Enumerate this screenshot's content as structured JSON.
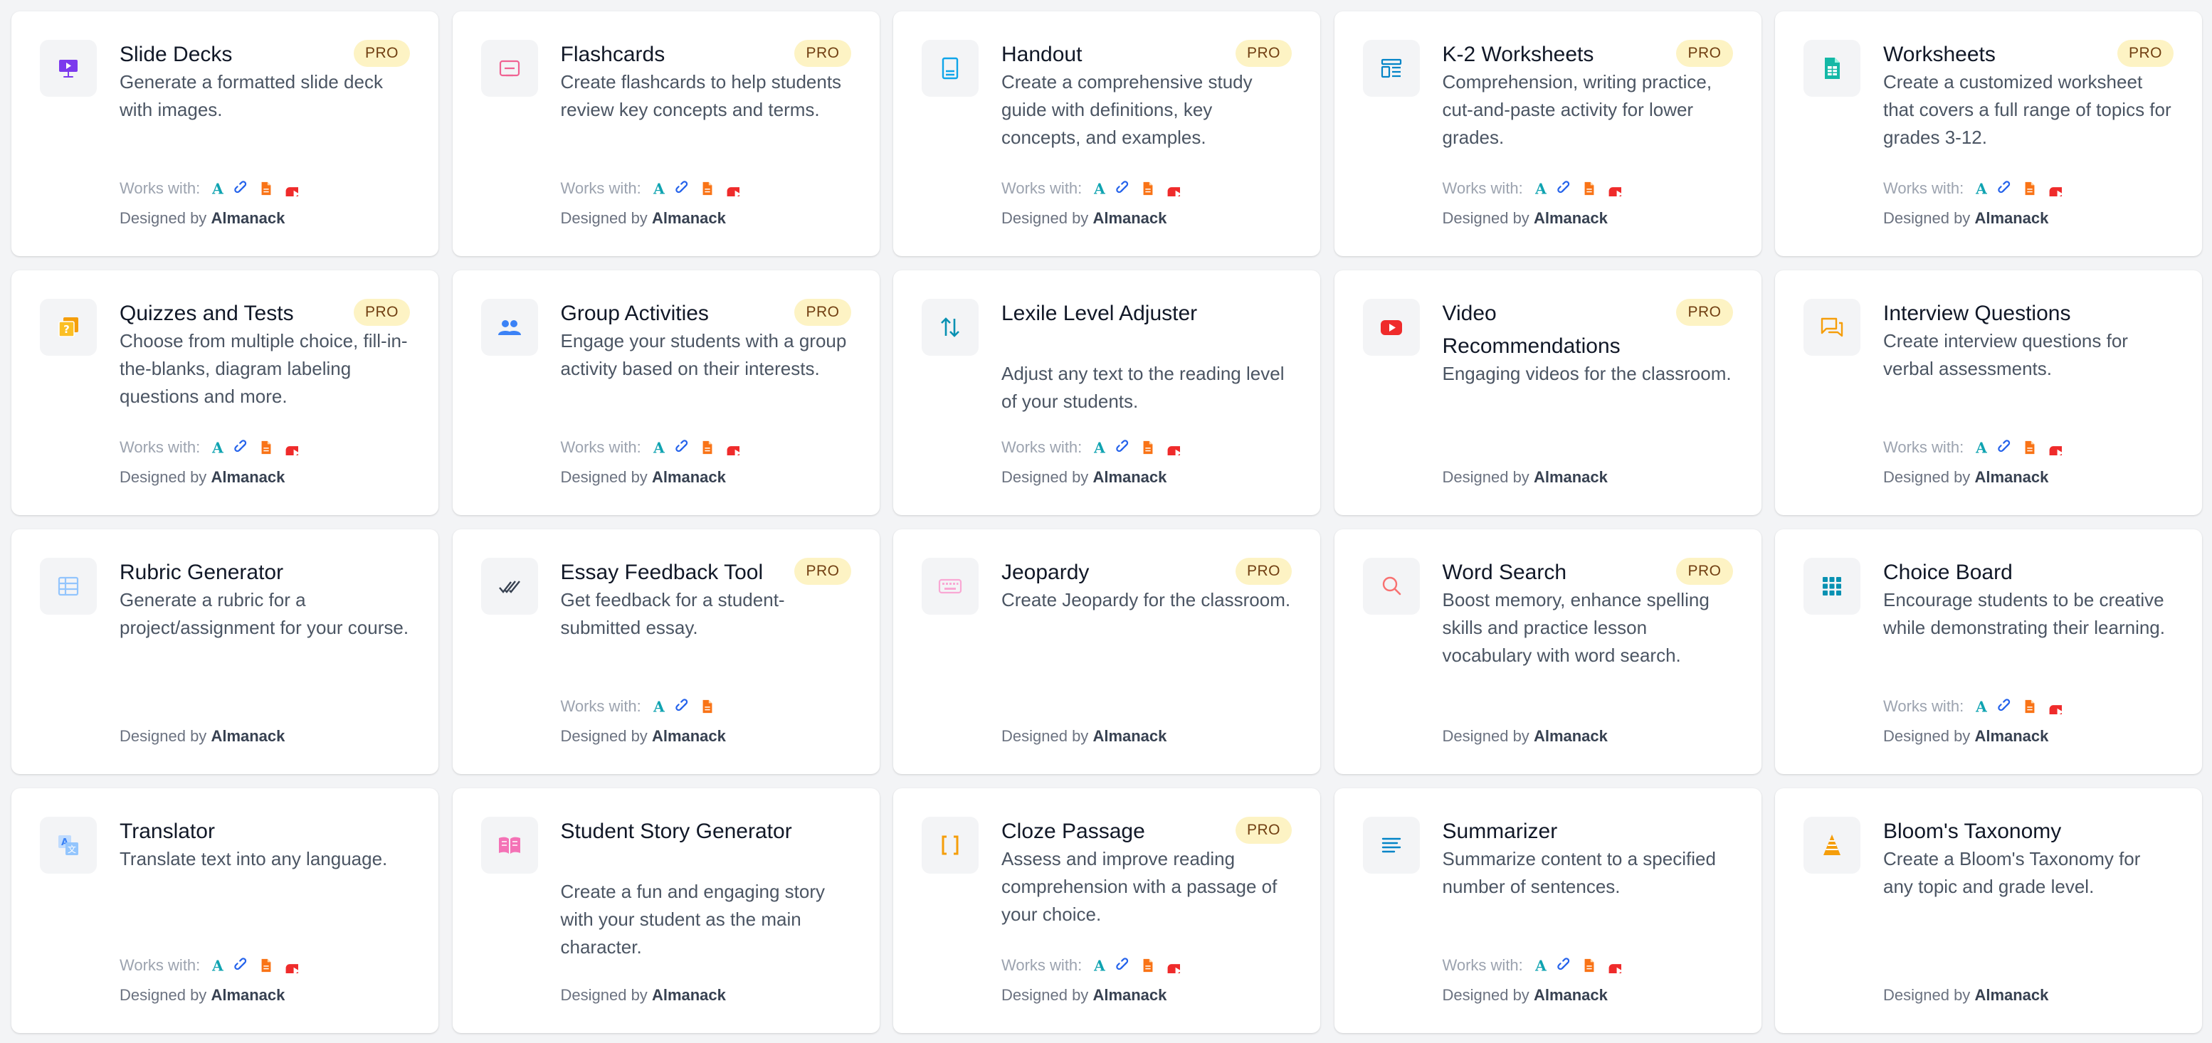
{
  "labels": {
    "pro": "PRO",
    "works_with": "Works with:",
    "designed_by": "Designed by",
    "designer": "Almanack"
  },
  "colors": {
    "page_bg": "#f3f4f6",
    "pro_bg": "#fdf3c4",
    "pro_text": "#713f12"
  },
  "integrations": [
    {
      "name": "almanack-a-icon",
      "color": "#0fa3b1"
    },
    {
      "name": "link-icon",
      "color": "#2563eb"
    },
    {
      "name": "document-icon",
      "color": "#f97316"
    },
    {
      "name": "youtube-icon",
      "color": "#ef2b2b"
    }
  ],
  "cards": [
    {
      "id": "slide-decks",
      "title": "Slide Decks",
      "description": "Generate a formatted slide deck with images.",
      "pro": true,
      "icon": "presentation-icon",
      "works_with": [
        0,
        1,
        2,
        3
      ]
    },
    {
      "id": "flashcards",
      "title": "Flashcards",
      "description": "Create flashcards to help students review key concepts and terms.",
      "pro": true,
      "icon": "flashcard-icon",
      "works_with": [
        0,
        1,
        2,
        3
      ]
    },
    {
      "id": "handout",
      "title": "Handout",
      "description": "Create a comprehensive study guide with definitions, key concepts, and examples.",
      "pro": true,
      "icon": "handout-icon",
      "works_with": [
        0,
        1,
        2,
        3
      ]
    },
    {
      "id": "k2-worksheets",
      "title": "K-2 Worksheets",
      "description": "Comprehension, writing practice, cut-and-paste activity for lower grades.",
      "pro": true,
      "icon": "layout-icon",
      "works_with": [
        0,
        1,
        2,
        3
      ]
    },
    {
      "id": "worksheets",
      "title": "Worksheets",
      "description": "Create a customized worksheet that covers a full range of topics for grades 3-12.",
      "pro": true,
      "icon": "spreadsheet-icon",
      "works_with": [
        0,
        1,
        2,
        3
      ]
    },
    {
      "id": "quizzes-and-tests",
      "title": "Quizzes and Tests",
      "description": "Choose from multiple choice, fill-in-the-blanks, diagram labeling questions and more.",
      "pro": true,
      "icon": "quiz-icon",
      "works_with": [
        0,
        1,
        2,
        3
      ]
    },
    {
      "id": "group-activities",
      "title": "Group Activities",
      "description": "Engage your students with a group activity based on their interests.",
      "pro": true,
      "icon": "people-icon",
      "works_with": [
        0,
        1,
        2,
        3
      ]
    },
    {
      "id": "lexile-level-adjuster",
      "title": "Lexile Level Adjuster",
      "description": "Adjust any text to the reading level of your students.",
      "pro": false,
      "icon": "arrows-updown-icon",
      "works_with": [
        0,
        1,
        2,
        3
      ]
    },
    {
      "id": "video-recommendations",
      "title": "Video Recommendations",
      "description": "Engaging videos for the classroom.",
      "pro": true,
      "icon": "youtube-icon",
      "works_with": []
    },
    {
      "id": "interview-questions",
      "title": "Interview Questions",
      "description": "Create interview questions for verbal assessments.",
      "pro": false,
      "icon": "chat-icon",
      "works_with": [
        0,
        1,
        2,
        3
      ]
    },
    {
      "id": "rubric-generator",
      "title": "Rubric Generator",
      "description": "Generate a rubric for a project/assignment for your course.",
      "pro": false,
      "icon": "table-icon",
      "works_with": []
    },
    {
      "id": "essay-feedback-tool",
      "title": "Essay Feedback Tool",
      "description": "Get feedback for a student-submitted essay.",
      "pro": true,
      "icon": "double-check-icon",
      "works_with": [
        0,
        1,
        2
      ]
    },
    {
      "id": "jeopardy",
      "title": "Jeopardy",
      "description": "Create Jeopardy for the classroom.",
      "pro": true,
      "icon": "keyboard-icon",
      "works_with": []
    },
    {
      "id": "word-search",
      "title": "Word Search",
      "description": "Boost memory, enhance spelling skills and practice lesson vocabulary with word search.",
      "pro": true,
      "icon": "magnifier-icon",
      "works_with": []
    },
    {
      "id": "choice-board",
      "title": "Choice Board",
      "description": "Encourage students to be creative while demonstrating their learning.",
      "pro": false,
      "icon": "grid-icon",
      "works_with": [
        0,
        1,
        2,
        3
      ]
    },
    {
      "id": "translator",
      "title": "Translator",
      "description": "Translate text into any language.",
      "pro": false,
      "icon": "translate-icon",
      "works_with": [
        0,
        1,
        2,
        3
      ]
    },
    {
      "id": "student-story-generator",
      "title": "Student Story Generator",
      "description": "Create a fun and engaging story with your student as the main character.",
      "pro": false,
      "icon": "open-book-icon",
      "works_with": []
    },
    {
      "id": "cloze-passage",
      "title": "Cloze Passage",
      "description": "Assess and improve reading comprehension with a passage of your choice.",
      "pro": true,
      "icon": "brackets-icon",
      "works_with": [
        0,
        1,
        2,
        3
      ]
    },
    {
      "id": "summarizer",
      "title": "Summarizer",
      "description": "Summarize content to a specified number of sentences.",
      "pro": false,
      "icon": "text-lines-icon",
      "works_with": [
        0,
        1,
        2,
        3
      ]
    },
    {
      "id": "blooms-taxonomy",
      "title": "Bloom's Taxonomy",
      "description": "Create a Bloom's Taxonomy for any topic and grade level.",
      "pro": false,
      "icon": "pyramid-icon",
      "works_with": []
    }
  ]
}
